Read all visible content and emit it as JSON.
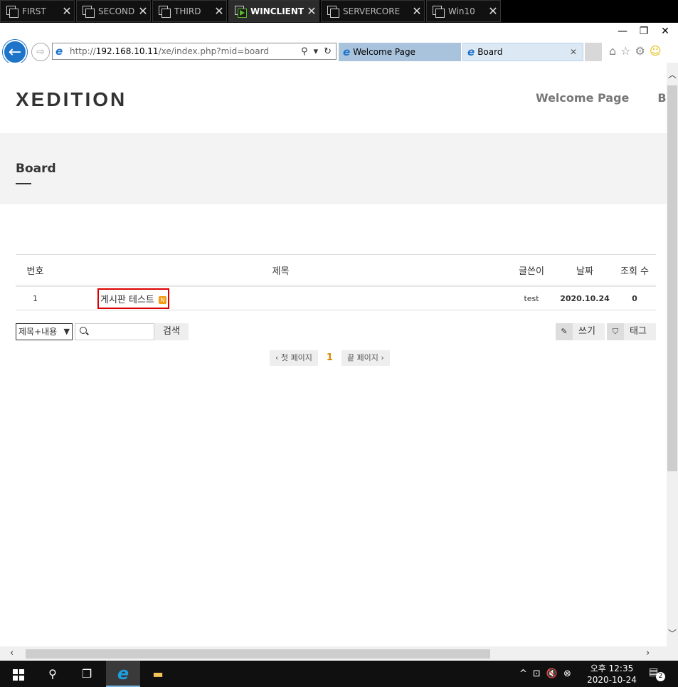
{
  "vm_tabs": [
    {
      "label": "FIRST",
      "active": false
    },
    {
      "label": "SECOND",
      "active": false
    },
    {
      "label": "THIRD",
      "active": false
    },
    {
      "label": "WINCLIENT",
      "active": true
    },
    {
      "label": "SERVERCORE",
      "active": false
    },
    {
      "label": "Win10",
      "active": false
    }
  ],
  "browser": {
    "url_prefix": "http://",
    "url_host": "192.168.10.11",
    "url_path": "/xe/index.php?mid=board",
    "tabs": [
      {
        "label": "Welcome Page"
      },
      {
        "label": "Board"
      }
    ]
  },
  "site": {
    "logo": "XEDITION",
    "nav": [
      "Welcome Page",
      "Board"
    ],
    "page_title": "Board"
  },
  "board": {
    "columns": [
      "번호",
      "제목",
      "글쓴이",
      "날짜",
      "조회 수"
    ],
    "rows": [
      {
        "no": "1",
        "title": "게시판 테스트",
        "new_badge": "N",
        "author": "test",
        "date": "2020.10.24",
        "views": "0"
      }
    ],
    "search_select": "제목+내용",
    "search_placeholder": "",
    "search_button": "검색",
    "write_button": "쓰기",
    "tag_button": "태그",
    "pager": {
      "first": "첫 페이지",
      "current": "1",
      "last": "끝 페이지"
    }
  },
  "taskbar": {
    "clock_time": "오후 12:35",
    "clock_date": "2020-10-24",
    "notification_count": "2"
  },
  "colors": {
    "ie_blue": "#1e74c9",
    "highlight_red": "#dd0000",
    "new_badge": "#f39c12",
    "vm_active_green": "#5cb82a"
  }
}
